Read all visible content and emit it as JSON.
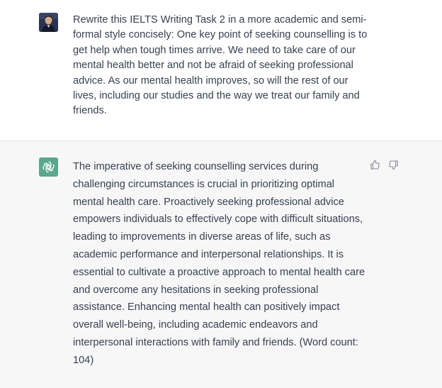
{
  "user": {
    "avatar": "user-avatar-photo",
    "message": "Rewrite this IELTS Writing Task 2 in a more academic and semi-formal style concisely: One key point of seeking counselling is to get help when tough times arrive. We need to take care of our mental health better and not be afraid of seeking professional advice. As our mental health improves, so will the rest of our lives, including our studies and the way we treat our family and friends."
  },
  "assistant": {
    "avatar": "openai-logo-icon",
    "message": "The imperative of seeking counselling services during challenging circumstances is crucial in prioritizing optimal mental health care. Proactively seeking professional advice empowers individuals to effectively cope with difficult situations, leading to improvements in diverse areas of life, such as academic performance and interpersonal relationships. It is essential to cultivate a proactive approach to mental health care and overcome any hesitations in seeking professional assistance. Enhancing mental health can positively impact overall well-being, including academic endeavors and interpersonal interactions with family and friends. (Word count: 104)",
    "feedback": {
      "thumbs_up": "thumbs-up-icon",
      "thumbs_down": "thumbs-down-icon"
    }
  },
  "colors": {
    "user_background": "#ffffff",
    "assistant_background": "#f7f7f8",
    "text": "#374151",
    "assistant_avatar": "#5aa78e"
  }
}
